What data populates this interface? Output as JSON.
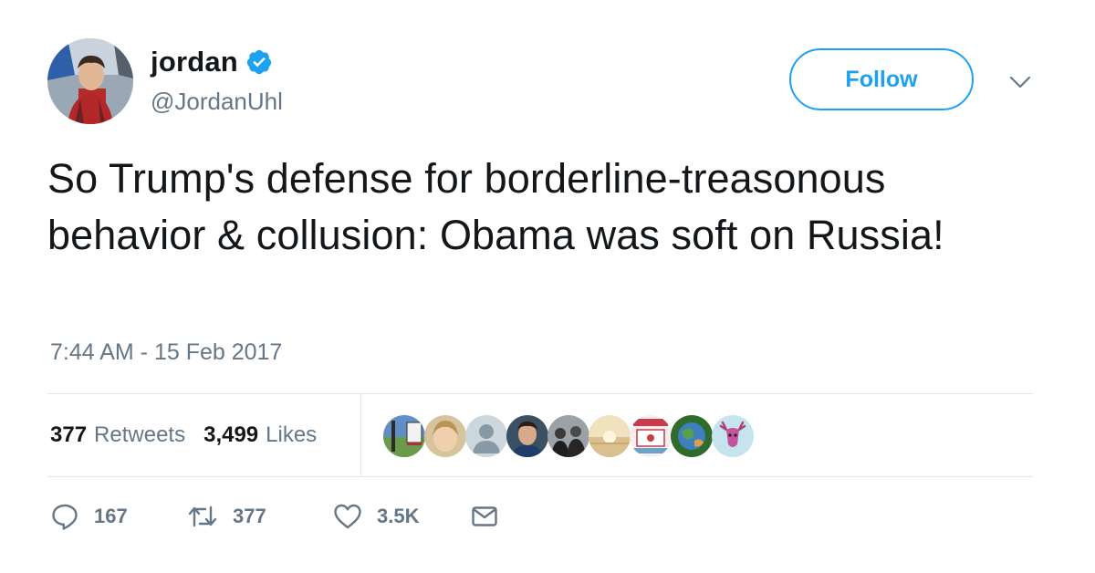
{
  "user": {
    "display_name": "jordan",
    "handle": "@JordanUhl",
    "verified": true,
    "avatar": "profile-photo"
  },
  "header": {
    "follow_label": "Follow",
    "menu_icon": "chevron-down-icon"
  },
  "tweet": {
    "text": "So Trump's defense for borderline-treasonous behavior & collusion: Obama was soft on Russia!",
    "timestamp": "7:44 AM - 15 Feb 2017"
  },
  "stats": {
    "retweets_count": "377",
    "retweets_label": "Retweets",
    "likes_count": "3,499",
    "likes_label": "Likes"
  },
  "likers": [
    {
      "icon": "liker-avatar-landscape"
    },
    {
      "icon": "liker-avatar-child"
    },
    {
      "icon": "liker-avatar-default"
    },
    {
      "icon": "liker-avatar-man"
    },
    {
      "icon": "liker-avatar-group"
    },
    {
      "icon": "liker-avatar-sunset"
    },
    {
      "icon": "liker-avatar-badge"
    },
    {
      "icon": "liker-avatar-globe"
    },
    {
      "icon": "liker-avatar-deer"
    }
  ],
  "actions": {
    "reply_count": "167",
    "retweet_count": "377",
    "like_count": "3.5K"
  },
  "colors": {
    "accent": "#1da1f2",
    "text": "#14171a",
    "muted": "#657786",
    "divider": "#e1e8ed"
  }
}
